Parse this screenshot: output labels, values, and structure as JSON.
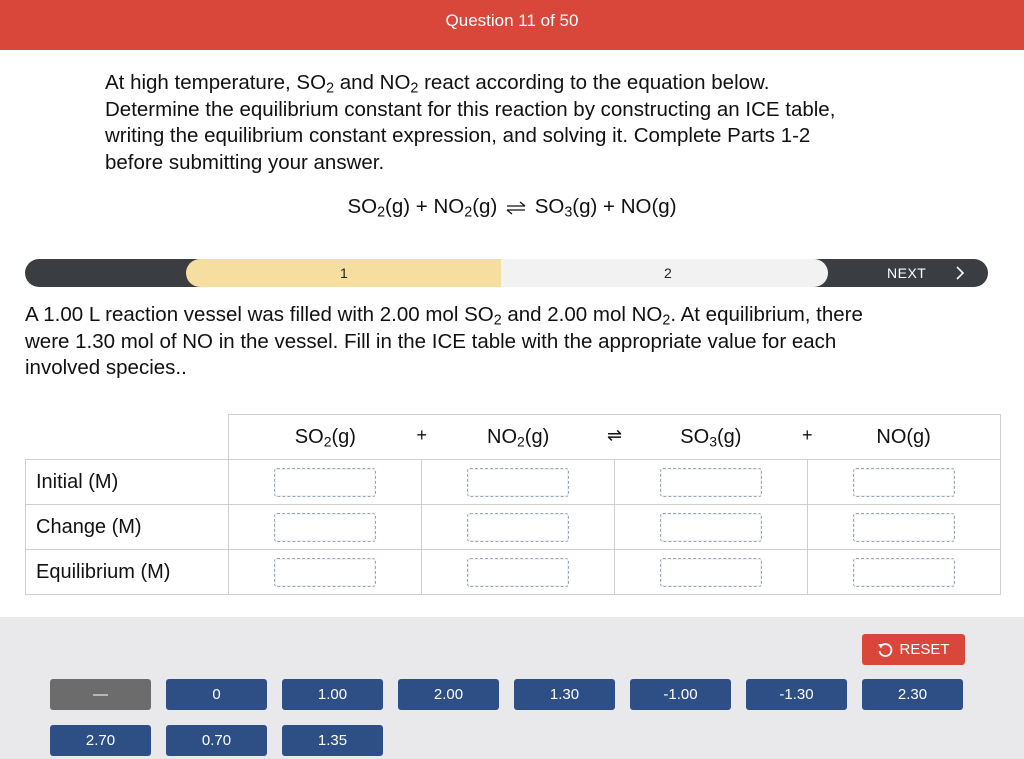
{
  "header": {
    "title": "Question 11 of 50"
  },
  "intro": {
    "line1_a": "At high temperature, SO",
    "line1_sub": "2",
    "line1_b": " and NO",
    "line1_sub2": "2",
    "line1_c": " react according to the equation below.",
    "line2": "Determine the equilibrium constant for this reaction by constructing an ICE table,",
    "line3": "writing the equilibrium constant expression, and solving it.  Complete Parts 1-2",
    "line4": "before submitting your answer."
  },
  "equation": {
    "r1": "SO",
    "r1_sub": "2",
    "r1_state": "(g)",
    "plus1": " + ",
    "r2": "NO",
    "r2_sub": "2",
    "r2_state": "(g)",
    "p1": "SO",
    "p1_sub": "3",
    "p1_state": "(g)",
    "plus2": " + ",
    "p2": "NO(g)"
  },
  "steps": {
    "step1": "1",
    "step2": "2",
    "next": "NEXT"
  },
  "prompt": {
    "a": "A 1.00 L reaction vessel was filled with 2.00 mol SO",
    "a_sub": "2",
    "b": " and 2.00 mol NO",
    "b_sub": "2",
    "c": ". At equilibrium, there",
    "line2": "were 1.30 mol of NO in the vessel. Fill in the ICE table with the appropriate value for each",
    "line3": "involved species.."
  },
  "ice_table": {
    "species": [
      {
        "name": "SO",
        "sub": "2",
        "state": "(g)"
      },
      {
        "name": "NO",
        "sub": "2",
        "state": "(g)"
      },
      {
        "name": "SO",
        "sub": "3",
        "state": "(g)"
      },
      {
        "name": "NO(g)",
        "sub": "",
        "state": ""
      }
    ],
    "operators": [
      "+",
      "⇌",
      "+"
    ],
    "rows": [
      "Initial (M)",
      "Change (M)",
      "Equilibrium (M)"
    ]
  },
  "answer_bank": {
    "reset_label": "RESET",
    "tiles_row1": [
      "—",
      "0",
      "1.00",
      "2.00",
      "1.30",
      "-1.00",
      "-1.30",
      "2.30"
    ],
    "tiles_row2": [
      "2.70",
      "0.70",
      "1.35"
    ]
  },
  "colors": {
    "header": "#d9473a",
    "tile": "#2d4f86",
    "tile_grey": "#6c6c6c",
    "step_active": "#f5dea0"
  }
}
